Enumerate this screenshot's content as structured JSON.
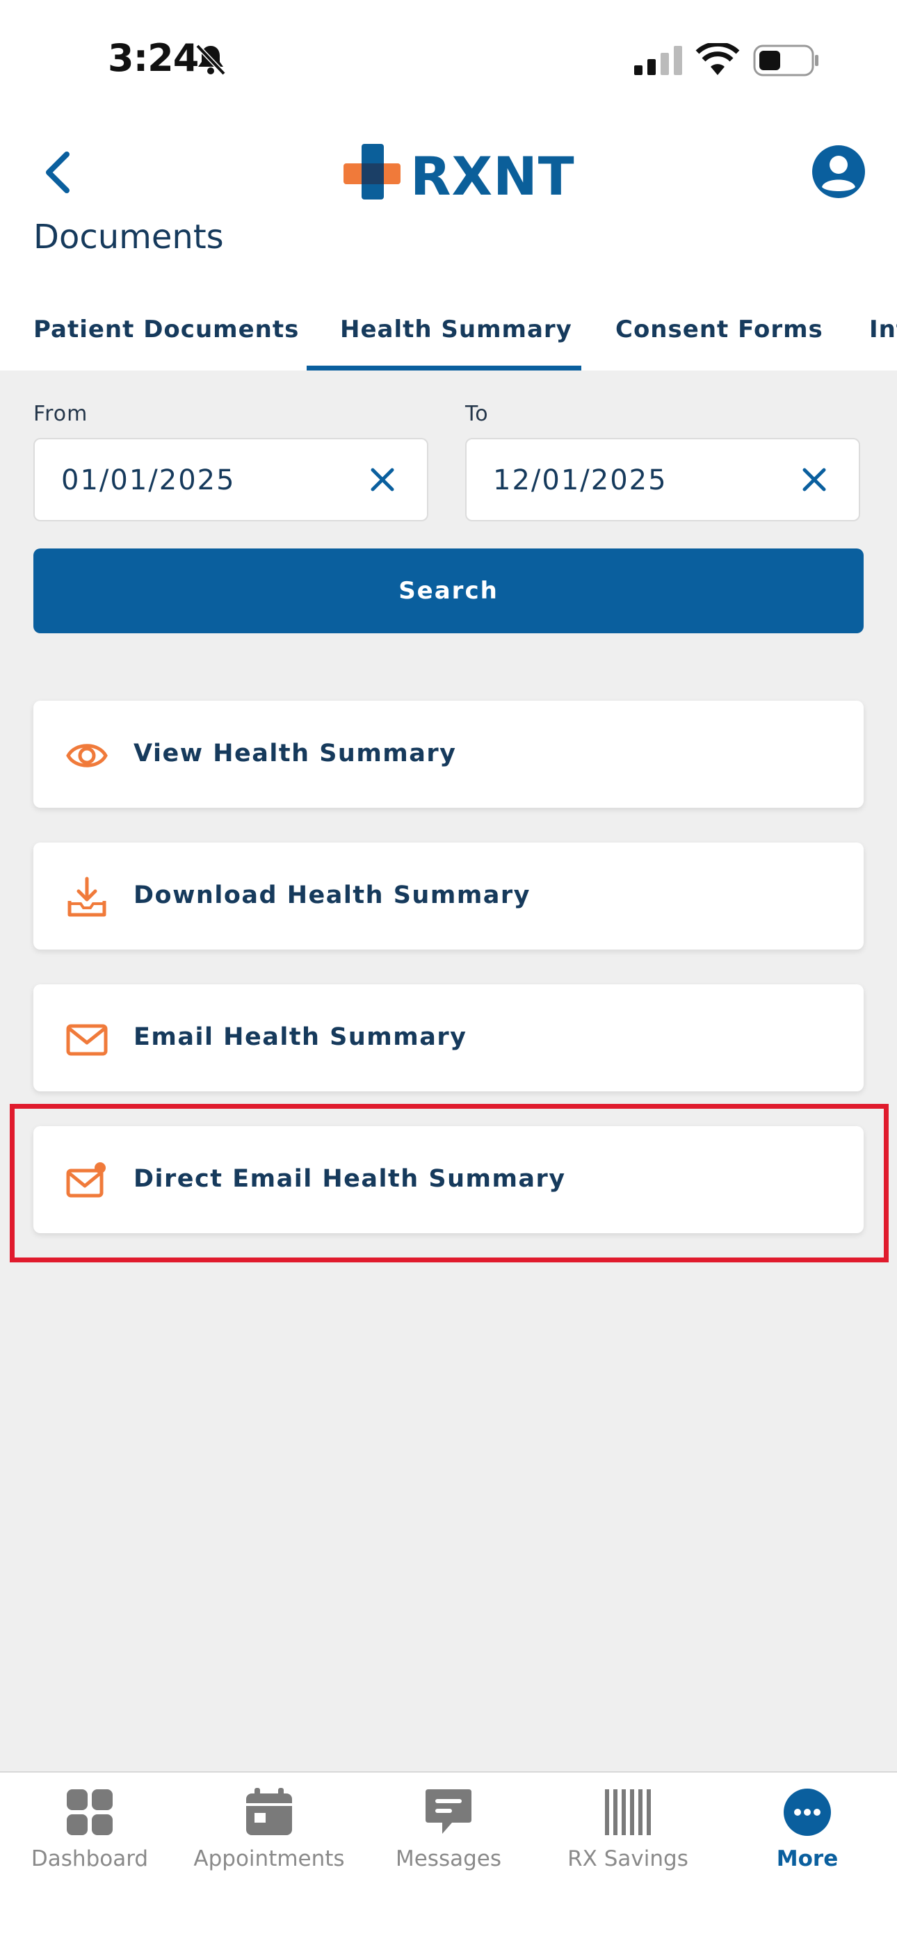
{
  "status_bar": {
    "time": "3:24"
  },
  "header": {
    "logo_text": "RXNT",
    "page_title": "Documents"
  },
  "tabs": [
    {
      "label": "Patient Documents"
    },
    {
      "label": "Health Summary",
      "active": true
    },
    {
      "label": "Consent Forms"
    },
    {
      "label": "Int"
    }
  ],
  "filters": {
    "from_label": "From",
    "from_value": "01/01/2025",
    "to_label": "To",
    "to_value": "12/01/2025",
    "search_label": "Search"
  },
  "actions": [
    {
      "label": "View Health Summary",
      "icon": "eye-icon"
    },
    {
      "label": "Download Health Summary",
      "icon": "download-icon"
    },
    {
      "label": "Email Health Summary",
      "icon": "mail-icon"
    },
    {
      "label": "Direct Email Health Summary",
      "icon": "mail-notification-icon"
    }
  ],
  "bottom_nav": [
    {
      "label": "Dashboard",
      "icon": "dashboard-icon"
    },
    {
      "label": "Appointments",
      "icon": "calendar-icon"
    },
    {
      "label": "Messages",
      "icon": "message-icon"
    },
    {
      "label": "RX Savings",
      "icon": "barcode-icon"
    },
    {
      "label": "More",
      "icon": "more-icon",
      "active": true
    }
  ],
  "colors": {
    "primary": "#0a5f9e",
    "accent": "#f07a3a",
    "text": "#163a5c",
    "highlight": "#e01b2d"
  }
}
